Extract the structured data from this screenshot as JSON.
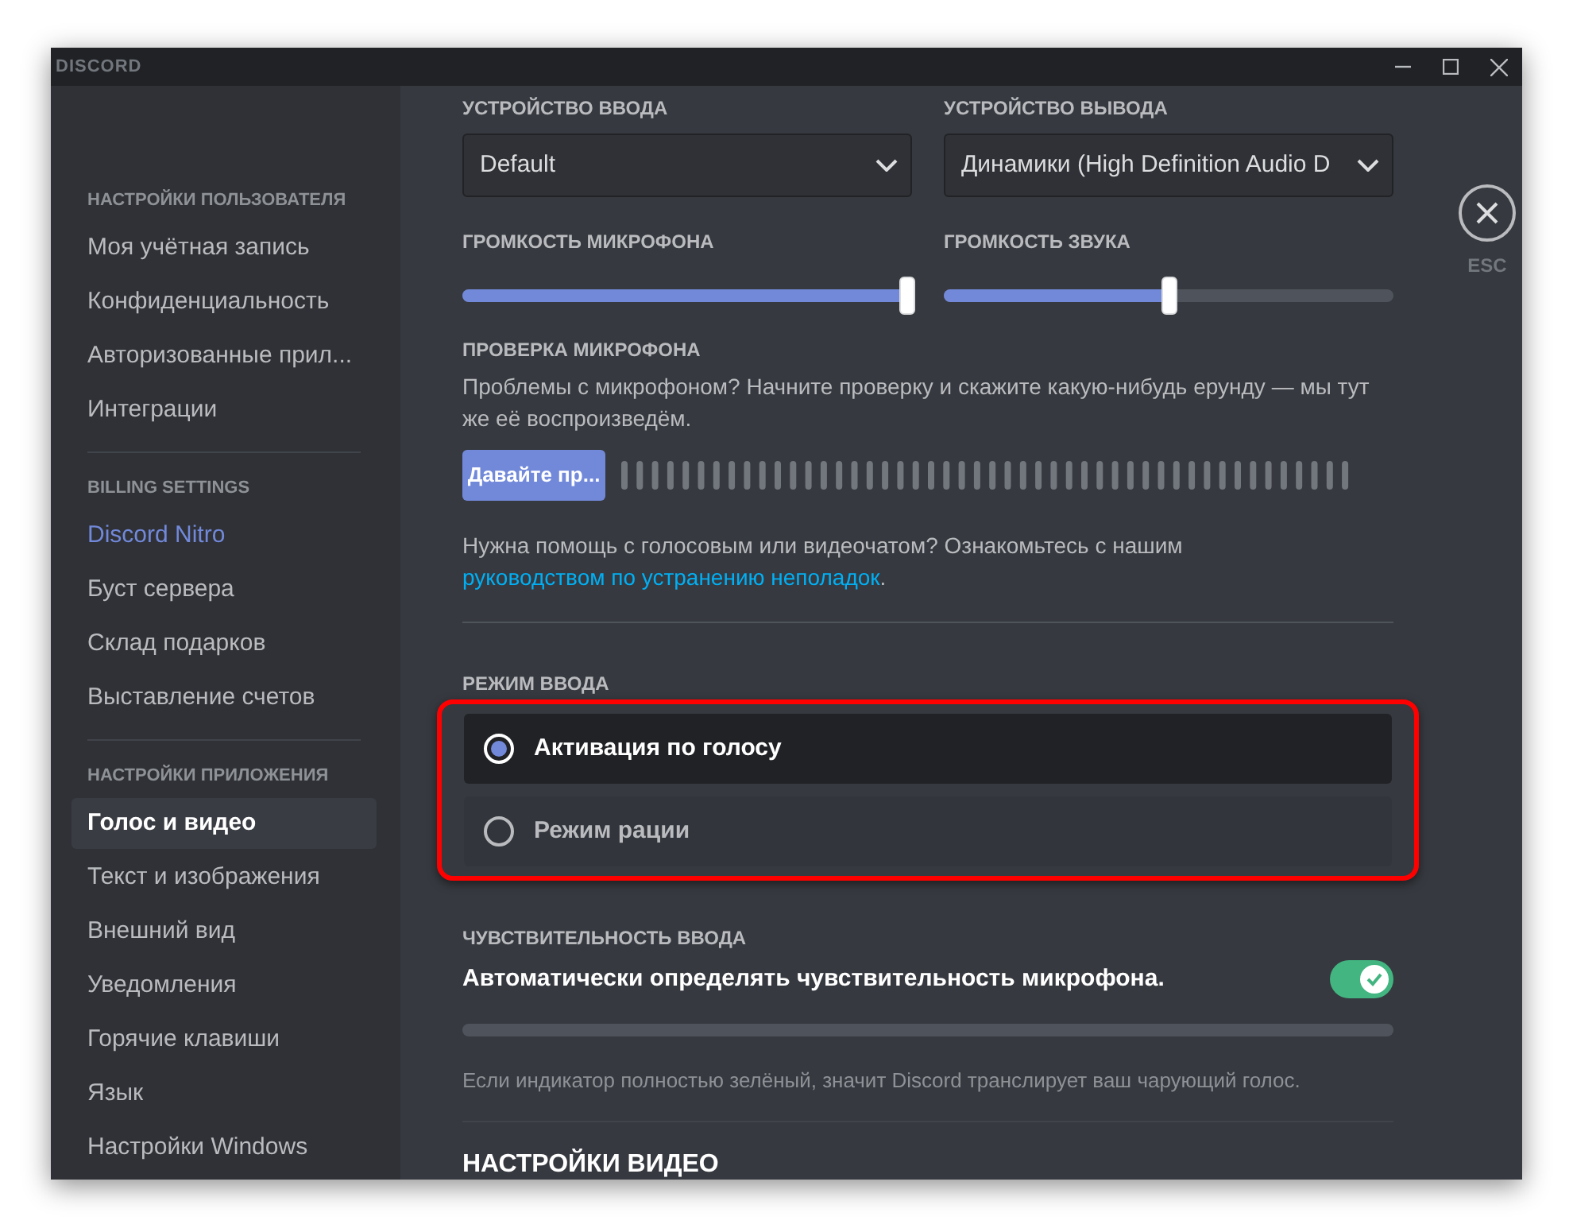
{
  "window": {
    "title": "DISCORD"
  },
  "sidebar": {
    "sections": [
      {
        "header": "НАСТРОЙКИ ПОЛЬЗОВАТЕЛЯ",
        "items": [
          {
            "label": "Моя учётная запись",
            "selected": false,
            "kind": "plain"
          },
          {
            "label": "Конфиденциальность",
            "selected": false,
            "kind": "plain"
          },
          {
            "label": "Авторизованные прил...",
            "selected": false,
            "kind": "plain"
          },
          {
            "label": "Интеграции",
            "selected": false,
            "kind": "plain"
          }
        ]
      },
      {
        "header": "BILLING SETTINGS",
        "items": [
          {
            "label": "Discord Nitro",
            "selected": false,
            "kind": "accent"
          },
          {
            "label": "Буст сервера",
            "selected": false,
            "kind": "plain"
          },
          {
            "label": "Склад подарков",
            "selected": false,
            "kind": "plain"
          },
          {
            "label": "Выставление счетов",
            "selected": false,
            "kind": "plain"
          }
        ]
      },
      {
        "header": "НАСТРОЙКИ ПРИЛОЖЕНИЯ",
        "items": [
          {
            "label": "Голос и видео",
            "selected": true,
            "kind": "plain"
          },
          {
            "label": "Текст и изображения",
            "selected": false,
            "kind": "plain"
          },
          {
            "label": "Внешний вид",
            "selected": false,
            "kind": "plain"
          },
          {
            "label": "Уведомления",
            "selected": false,
            "kind": "plain"
          },
          {
            "label": "Горячие клавиши",
            "selected": false,
            "kind": "plain"
          },
          {
            "label": "Язык",
            "selected": false,
            "kind": "plain"
          },
          {
            "label": "Настройки Windows",
            "selected": false,
            "kind": "plain"
          }
        ]
      }
    ]
  },
  "close": {
    "label": "ESC"
  },
  "devices": [
    {
      "label": "УСТРОЙСТВО ВВОДА",
      "value": "Default"
    },
    {
      "label": "УСТРОЙСТВО ВЫВОДА",
      "value": "Динамики (High Definition Audio D"
    }
  ],
  "volumes": [
    {
      "label": "ГРОМКОСТЬ МИКРОФОНА",
      "level": 0.99
    },
    {
      "label": "ГРОМКОСТЬ ЗВУКА",
      "level": 0.5
    }
  ],
  "mic_test": {
    "label": "ПРОВЕРКА МИКРОФОНА",
    "description": "Проблемы с микрофоном? Начните проверку и скажите какую-нибудь ерунду — мы тут же её воспроизведём.",
    "button": "Давайте пр..."
  },
  "help": {
    "text": "Нужна помощь с голосовым или видеочатом? Ознакомьтесь с нашим ",
    "link": "руководством по устранению неполадок",
    "end": "."
  },
  "input_mode": {
    "label": "РЕЖИМ ВВОДА",
    "highlighted": true,
    "options": [
      {
        "label": "Активация по голосу",
        "selected": true
      },
      {
        "label": "Режим рации",
        "selected": false
      }
    ]
  },
  "sensitivity": {
    "label": "ЧУВСТВИТЕЛЬНОСТЬ ВВОДА",
    "auto_label": "Автоматически определять чувствительность микрофона.",
    "on": true,
    "hint": "Если индикатор полностью зелёный, значит Discord транслирует ваш чарующий голос."
  },
  "video_header": "НАСТРОЙКИ ВИДЕО"
}
